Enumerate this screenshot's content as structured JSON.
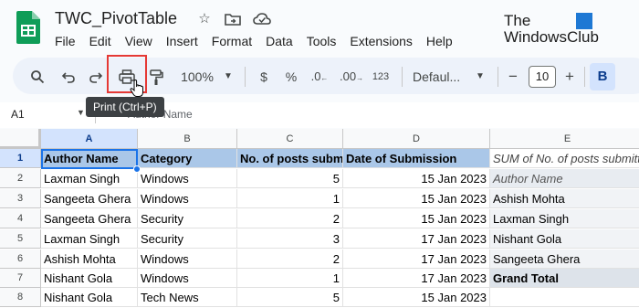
{
  "doc": {
    "title": "TWC_PivotTable",
    "menu": [
      "File",
      "Edit",
      "View",
      "Insert",
      "Format",
      "Data",
      "Tools",
      "Extensions",
      "Help"
    ]
  },
  "watermark": {
    "line1": "The",
    "line2": "WindowsClub"
  },
  "toolbar": {
    "zoom": "100%",
    "currency": "$",
    "percent": "%",
    "decrease_decimals": ".0",
    "number_format": "123",
    "font_name": "Defaul...",
    "font_size": "10",
    "minus": "−",
    "plus": "+",
    "bold": "B"
  },
  "tooltip": "Print (Ctrl+P)",
  "formula_bar": {
    "cell_ref": "A1",
    "content": "Author Name"
  },
  "columns": [
    "A",
    "B",
    "C",
    "D",
    "E"
  ],
  "rows": [
    "1",
    "2",
    "3",
    "4",
    "5",
    "6",
    "7",
    "8"
  ],
  "header_row": [
    "Author Name",
    "Category",
    "No. of posts submitted",
    "Date of Submission"
  ],
  "data_rows": [
    [
      "Laxman Singh",
      "Windows",
      "5",
      "15 Jan 2023"
    ],
    [
      "Sangeeta Ghera",
      "Windows",
      "1",
      "15 Jan 2023"
    ],
    [
      "Sangeeta Ghera",
      "Security",
      "2",
      "15 Jan 2023"
    ],
    [
      "Laxman Singh",
      "Security",
      "3",
      "17 Jan 2023"
    ],
    [
      "Ashish Mohta",
      "Windows",
      "2",
      "17 Jan 2023"
    ],
    [
      "Nishant Gola",
      "Windows",
      "1",
      "17 Jan 2023"
    ],
    [
      "Nishant Gola",
      "Tech News",
      "5",
      "15 Jan 2023"
    ]
  ],
  "pivot": {
    "title": "SUM of No. of posts submitted",
    "row_label": "Author Name",
    "rows": [
      "Ashish Mohta",
      "Laxman Singh",
      "Nishant Gola",
      "Sangeeta Ghera"
    ],
    "total_label": "Grand Total"
  }
}
